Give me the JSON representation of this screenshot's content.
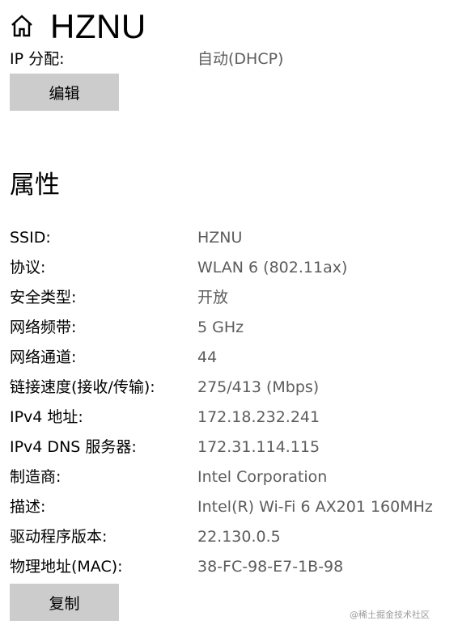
{
  "header": {
    "title": "HZNU",
    "home_icon": "home-icon"
  },
  "cut_row": {
    "label": "IP 分配:",
    "value": "自动(DHCP)"
  },
  "buttons": {
    "edit_label": "编辑",
    "copy_label": "复制"
  },
  "properties": {
    "title": "属性",
    "rows": [
      {
        "label": "SSID:",
        "value": "HZNU"
      },
      {
        "label": "协议:",
        "value": "WLAN 6 (802.11ax)"
      },
      {
        "label": "安全类型:",
        "value": "开放"
      },
      {
        "label": "网络频带:",
        "value": "5 GHz"
      },
      {
        "label": "网络通道:",
        "value": "44"
      },
      {
        "label": "链接速度(接收/传输):",
        "value": "275/413 (Mbps)"
      },
      {
        "label": "IPv4 地址:",
        "value": "172.18.232.241"
      },
      {
        "label": "IPv4 DNS 服务器:",
        "value": "172.31.114.115"
      },
      {
        "label": "制造商:",
        "value": "Intel Corporation"
      },
      {
        "label": "描述:",
        "value": "Intel(R) Wi-Fi 6 AX201 160MHz"
      },
      {
        "label": "驱动程序版本:",
        "value": "22.130.0.5"
      },
      {
        "label": "物理地址(MAC):",
        "value": "38-FC-98-E7-1B-98"
      }
    ]
  },
  "watermark": "@稀土掘金技术社区"
}
